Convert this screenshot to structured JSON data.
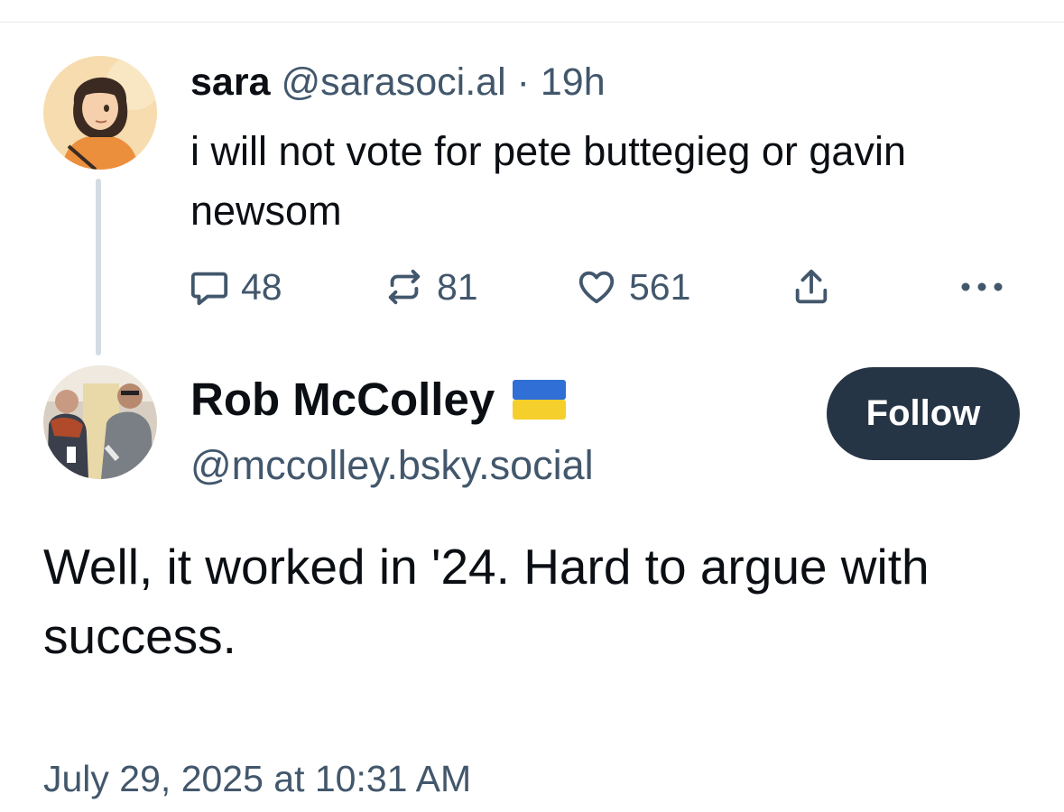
{
  "parent_post": {
    "author_name": "sara",
    "handle": "@sarasoci.al",
    "separator": "·",
    "time_ago": "19h",
    "text": "i will not vote for pete buttegieg or gavin newsom",
    "actions": {
      "replies": "48",
      "reposts": "81",
      "likes": "561"
    }
  },
  "reply_post": {
    "author_name": "Rob McColley",
    "flag_emoji": "🇺🇦",
    "handle": "@mccolley.bsky.social",
    "follow_label": "Follow",
    "text": "Well, it worked in '24. Hard to argue with success.",
    "timestamp": "July 29, 2025 at 10:31 AM"
  },
  "icons": {
    "reply": "speech-bubble-icon",
    "repost": "repost-arrows-icon",
    "like": "heart-icon",
    "share": "share-upload-icon",
    "more": "ellipsis-icon"
  },
  "colors": {
    "text_primary": "#0b0f14",
    "text_secondary": "#42576c",
    "follow_button_bg": "#263545",
    "thread_line": "#d4dbe2"
  }
}
